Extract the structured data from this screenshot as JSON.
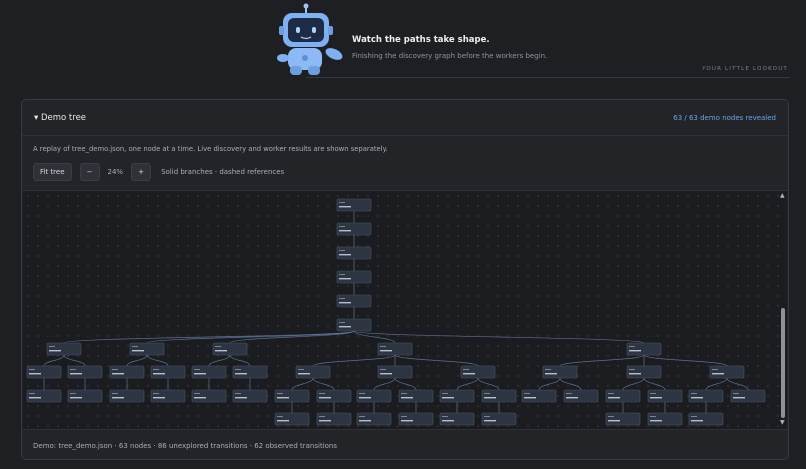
{
  "hero": {
    "title": "Watch the paths take shape.",
    "subtitle": "Finishing the discovery graph before the workers begin.",
    "tagline": "YOUR LITTLE LOOKOUT"
  },
  "panel": {
    "title": "▾ Demo tree",
    "revealed": "63 / 63 demo nodes revealed",
    "description": "A replay of tree_demo.json, one node at a time. Live discovery and worker results are shown separately.",
    "controls": {
      "fit_label": "Fit tree",
      "zoom_out_label": "−",
      "zoom_level": "24%",
      "zoom_in_label": "+",
      "legend": "Solid branches · dashed references"
    },
    "footer": "Demo: tree_demo.json · 63 nodes · 86 unexplored transitions · 62 observed transitions"
  },
  "colors": {
    "accent": "#6aa3ea",
    "node_fill": "#2d3442",
    "node_stroke": "#4a5568",
    "edge": "#6e87b0"
  },
  "icons": {
    "scroll_up": "triangle-up-icon",
    "scroll_down": "triangle-down-icon"
  }
}
